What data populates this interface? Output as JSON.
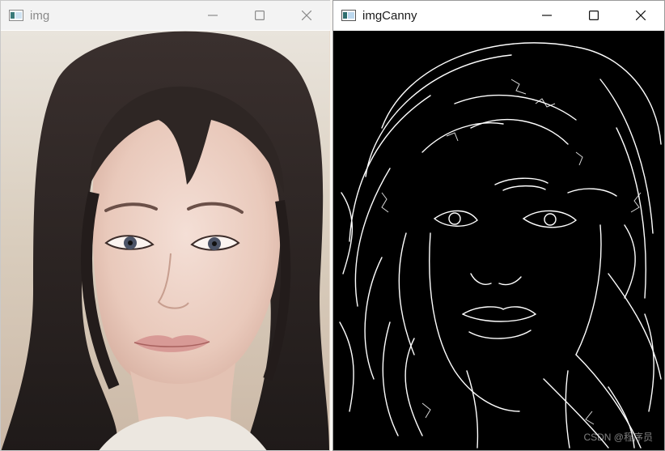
{
  "windows": {
    "left": {
      "title": "img",
      "icon": "opencv-window-icon",
      "controls": [
        "minimize-icon",
        "maximize-icon",
        "close-icon"
      ]
    },
    "right": {
      "title": "imgCanny",
      "icon": "opencv-window-icon",
      "controls": [
        "minimize-icon",
        "maximize-icon",
        "close-icon"
      ],
      "watermark": "CSDN @程序员"
    }
  },
  "colors": {
    "canny_background": "#000000",
    "canny_edges": "#ffffff",
    "titlebar_inactive": "#f3f3f3",
    "titlebar_active": "#ffffff"
  }
}
